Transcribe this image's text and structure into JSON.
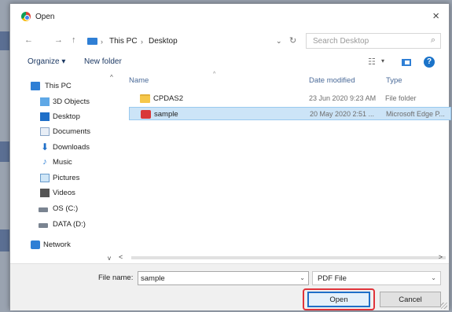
{
  "dialog": {
    "title": "Open",
    "close_glyph": "×"
  },
  "navigation": {
    "back_glyph": "←",
    "forward_glyph": "→",
    "up_glyph": "↑",
    "breadcrumb": [
      "This PC",
      "Desktop"
    ],
    "separator": "›",
    "dropdown_glyph": "⌄",
    "refresh_glyph": "↻",
    "search_placeholder": "Search Desktop",
    "search_glyph": "⌕"
  },
  "toolbar": {
    "organize_label": "Organize ▾",
    "new_folder_label": "New folder",
    "view_glyph": "☷",
    "view_chevron": "▾",
    "help_glyph": "?"
  },
  "sidebar": {
    "collapse_glyph": "^",
    "items": [
      {
        "label": "This PC",
        "icon": "pc-icon"
      },
      {
        "label": "3D Objects",
        "icon": "3d-objects-icon"
      },
      {
        "label": "Desktop",
        "icon": "desktop-icon"
      },
      {
        "label": "Documents",
        "icon": "documents-icon"
      },
      {
        "label": "Downloads",
        "icon": "downloads-icon"
      },
      {
        "label": "Music",
        "icon": "music-icon"
      },
      {
        "label": "Pictures",
        "icon": "pictures-icon"
      },
      {
        "label": "Videos",
        "icon": "videos-icon"
      },
      {
        "label": "OS (C:)",
        "icon": "drive-icon"
      },
      {
        "label": "DATA (D:)",
        "icon": "drive-icon"
      },
      {
        "label": "Network",
        "icon": "network-icon"
      }
    ]
  },
  "file_list": {
    "columns": [
      "Name",
      "Date modified",
      "Type"
    ],
    "sort_glyph": "^",
    "rows": [
      {
        "name": "CPDAS2",
        "date": "23 Jun 2020 9:23 AM",
        "type": "File folder",
        "icon": "folder-icon"
      },
      {
        "name": "sample",
        "date": "20 May 2020 2:51 ...",
        "type": "Microsoft Edge P...",
        "icon": "pdf-icon"
      }
    ]
  },
  "scroll": {
    "left_glyph": "<",
    "right_glyph": ">",
    "down_glyph": "v"
  },
  "footer": {
    "file_name_label": "File name:",
    "file_name_value": "sample",
    "file_name_chevron": "⌄",
    "filter_value": "PDF File",
    "filter_chevron": "⌄",
    "open_label": "Open",
    "cancel_label": "Cancel"
  },
  "colors": {
    "accent": "#1f6fc8",
    "highlight": "#e0333a",
    "selection": "#cce4f7"
  }
}
